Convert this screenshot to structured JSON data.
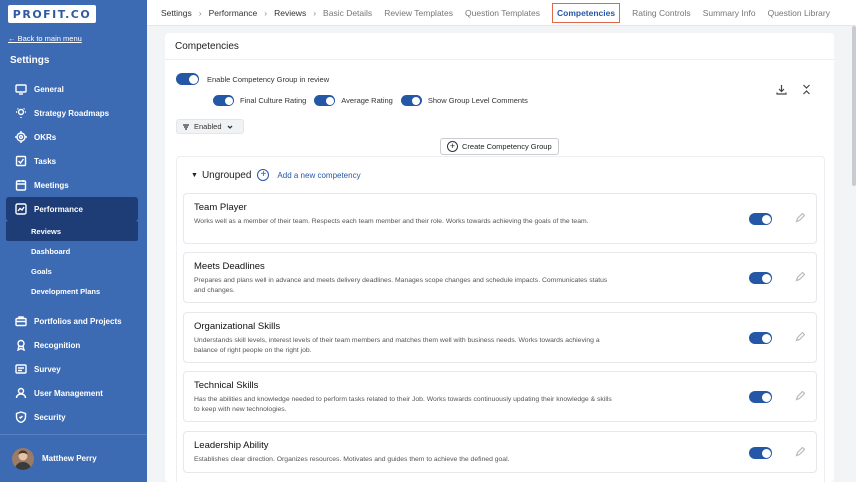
{
  "sidebar": {
    "logo": "PROFIT.CO",
    "back_link": "← Back to main menu",
    "title": "Settings",
    "items": [
      {
        "label": "General",
        "icon": "monitor-icon"
      },
      {
        "label": "Strategy Roadmaps",
        "icon": "bulb-icon"
      },
      {
        "label": "OKRs",
        "icon": "target-icon"
      },
      {
        "label": "Tasks",
        "icon": "checkbox-icon"
      },
      {
        "label": "Meetings",
        "icon": "calendar-icon"
      },
      {
        "label": "Performance",
        "icon": "chart-icon",
        "active": true
      }
    ],
    "sub_items": [
      {
        "label": "Reviews",
        "active": true
      },
      {
        "label": "Dashboard"
      },
      {
        "label": "Goals"
      },
      {
        "label": "Development Plans"
      }
    ],
    "items_after": [
      {
        "label": "Portfolios and Projects",
        "icon": "briefcase-icon"
      },
      {
        "label": "Recognition",
        "icon": "award-icon"
      },
      {
        "label": "Survey",
        "icon": "survey-icon"
      },
      {
        "label": "User Management",
        "icon": "user-icon"
      },
      {
        "label": "Security",
        "icon": "shield-icon"
      }
    ],
    "user_name": "Matthew Perry"
  },
  "topbar": {
    "breadcrumbs": [
      "Settings",
      "Performance",
      "Reviews"
    ],
    "tabs": [
      "Basic Details",
      "Review Templates",
      "Question Templates",
      "Competencies",
      "Rating Controls",
      "Summary Info",
      "Question Library"
    ],
    "active_tab": "Competencies"
  },
  "panel": {
    "title": "Competencies",
    "enable_label": "Enable Competency Group in review",
    "sub_options": [
      "Final Culture Rating",
      "Average Rating",
      "Show Group Level Comments"
    ],
    "filter_label": "Enabled",
    "create_label": "Create Competency Group",
    "group_label": "Ungrouped",
    "add_label": "Add a new competency"
  },
  "competencies": [
    {
      "title": "Team Player",
      "desc": "Works well as a member of their team. Respects each team member and their role. Works towards achieving the goals of the team.",
      "enabled": true
    },
    {
      "title": "Meets Deadlines",
      "desc": "Prepares and plans well in advance and meets delivery deadlines. Manages scope changes and schedule impacts. Communicates status and changes.",
      "enabled": true
    },
    {
      "title": "Organizational Skills",
      "desc": "Understands skill levels, interest levels of their team members and matches them well with business needs. Works towards achieving a balance of right people on the right job.",
      "enabled": true
    },
    {
      "title": "Technical Skills",
      "desc": "Has the abilities and knowledge needed to perform tasks related to their Job. Works towards continuously updating their knowledge & skills to keep with new technologies.",
      "enabled": true
    },
    {
      "title": "Leadership Ability",
      "desc": "Establishes clear direction. Organizes resources. Motivates and guides them to achieve the defined goal.",
      "enabled": true
    }
  ],
  "colors": {
    "sidebar": "#3d6bb3",
    "accent": "#2458a6",
    "active_tab_outline": "#e0674a"
  }
}
